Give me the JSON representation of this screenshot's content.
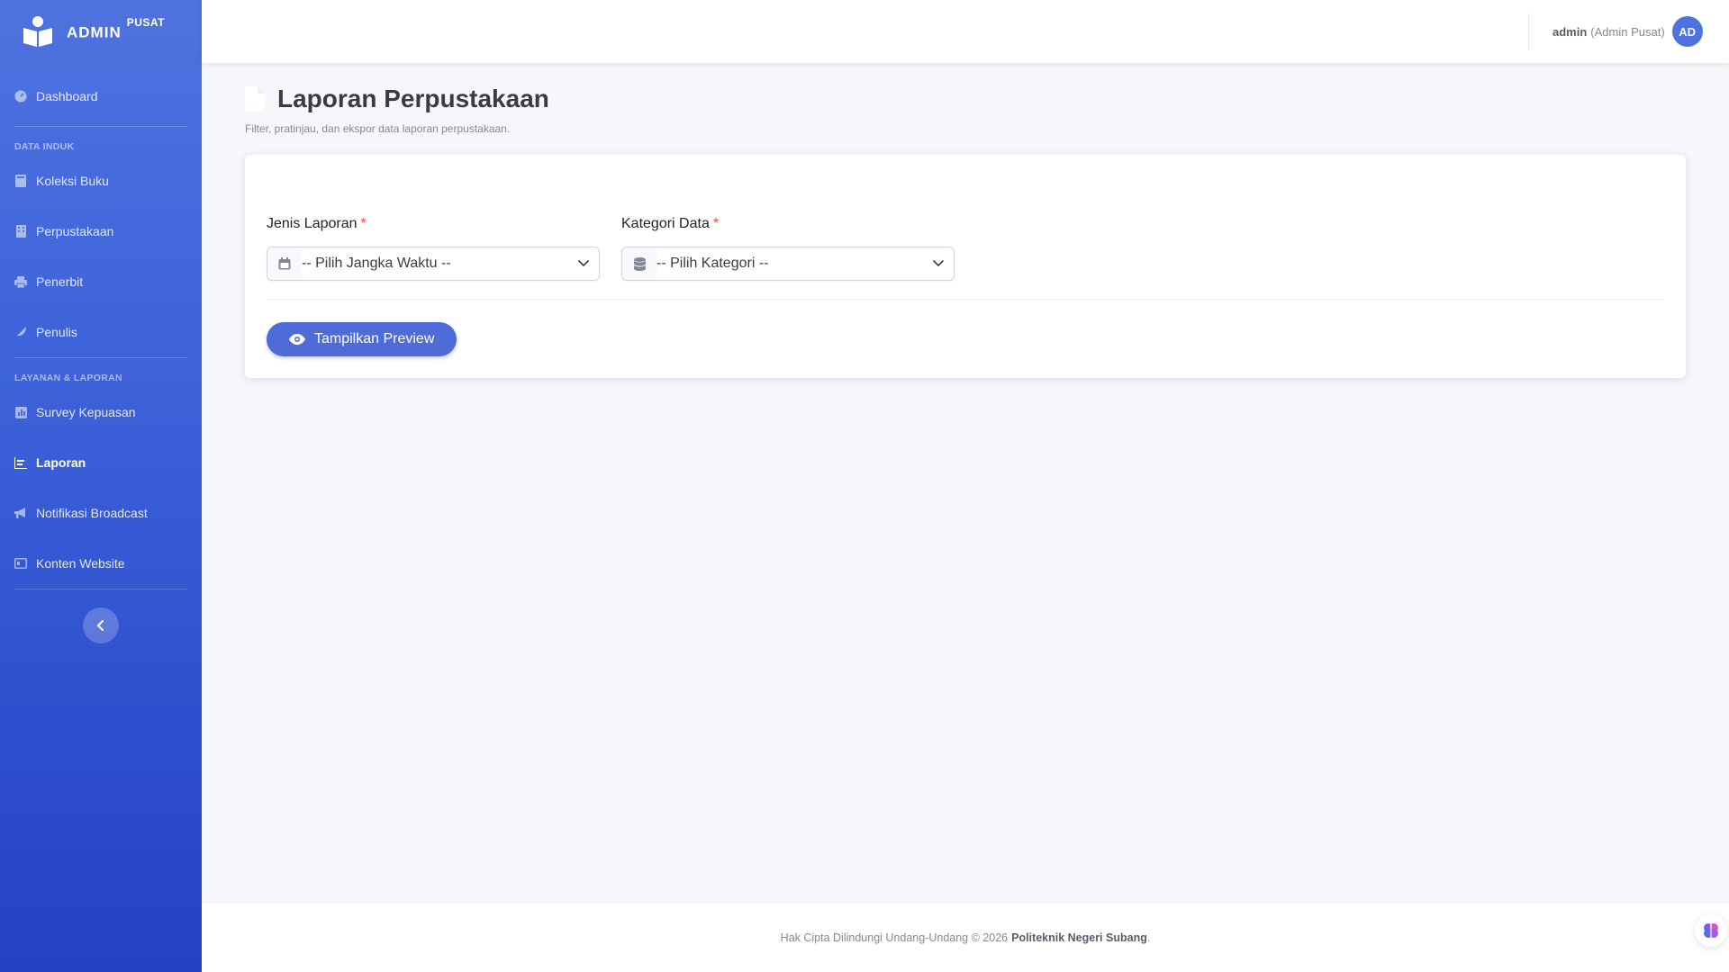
{
  "brand": {
    "title": "ADMIN",
    "badge": "PUSAT"
  },
  "sidebar": {
    "dashboard": "Dashboard",
    "heading_data": "DATA INDUK",
    "items_data": [
      "Koleksi Buku",
      "Perpustakaan",
      "Penerbit",
      "Penulis"
    ],
    "heading_layanan": "LAYANAN & LAPORAN",
    "items_layanan": [
      "Survey Kepuasan",
      "Laporan",
      "Notifikasi Broadcast",
      "Konten Website"
    ],
    "active_item": "Laporan"
  },
  "topbar": {
    "user_name": "admin",
    "user_role": "(Admin Pusat)",
    "avatar_initials": "AD"
  },
  "page": {
    "title": "Laporan Perpustakaan",
    "subtitle": "Filter, pratinjau, dan ekspor data laporan perpustakaan."
  },
  "form": {
    "jenis_label": "Jenis Laporan",
    "jenis_value": "-- Pilih Jangka Waktu --",
    "kategori_label": "Kategori Data",
    "kategori_value": "-- Pilih Kategori --",
    "required_mark": "*",
    "preview_button": "Tampilkan Preview"
  },
  "footer": {
    "text": "Hak Cipta Dilindungi Undang-Undang © 2026",
    "org": "Politeknik Negeri Subang",
    "suffix": "."
  },
  "colors": {
    "sidebar_top": "#4e73df",
    "sidebar_bottom": "#2442c4",
    "primary": "#4e6bd8",
    "required": "#e74a3b"
  },
  "icons": {
    "brand": "reader-book-icon",
    "jenis": "calendar-icon",
    "kategori": "database-icon",
    "preview": "eye-icon",
    "collapse": "chevron-left-icon",
    "floating": "brain-icon"
  }
}
